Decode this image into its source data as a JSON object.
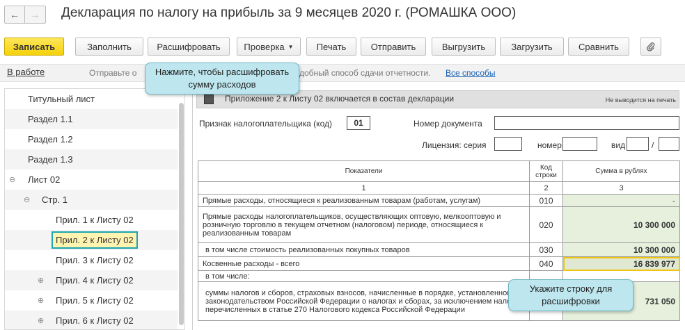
{
  "window": {
    "title": "Декларация по налогу на прибыль за 9 месяцев 2020 г. (РОМАШКА ООО)",
    "back_icon": "arrow-left",
    "forward_icon": "arrow-right"
  },
  "toolbar": {
    "save": "Записать",
    "fill": "Заполнить",
    "decode": "Расшифровать",
    "check": "Проверка",
    "print": "Печать",
    "send": "Отправить",
    "export": "Выгрузить",
    "import": "Загрузить",
    "compare": "Сравнить",
    "attach_icon": "paperclip",
    "accent_color": "#f5d20a"
  },
  "status": {
    "work_link": "В работе",
    "hint_start": "Отправьте о",
    "hint_end": "добный способ сдачи отчетности.",
    "all_ways_link": "Все способы"
  },
  "tooltips": {
    "decode_hint": "Нажмите, чтобы расшифровать сумму расходов",
    "row_hint": "Укажите строку для расшифровки"
  },
  "sidebar": {
    "items": [
      {
        "label": "Титульный лист"
      },
      {
        "label": "Раздел 1.1"
      },
      {
        "label": "Раздел 1.2"
      },
      {
        "label": "Раздел 1.3"
      },
      {
        "label": "Лист 02",
        "toggle": "⊖"
      },
      {
        "label": "Стр. 1",
        "toggle": "⊖"
      },
      {
        "label": "Прил. 1 к Листу 02"
      },
      {
        "label": "Прил. 2 к Листу 02"
      },
      {
        "label": "Прил. 3 к Листу 02"
      },
      {
        "label": "Прил. 4 к Листу 02",
        "toggle": "⊕"
      },
      {
        "label": "Прил. 5 к Листу 02",
        "toggle": "⊕"
      },
      {
        "label": "Прил. 6 к Листу 02",
        "toggle": "⊕"
      }
    ]
  },
  "form": {
    "appendix_label": "Приложение 2 к Листу 02 включается в состав декларации",
    "no_print": "Не выводится на печать",
    "taxpayer_sign_label": "Признак налогоплательщика (код)",
    "taxpayer_sign_value": "01",
    "doc_number_label": "Номер документа",
    "license_series_label": "Лицензия: серия",
    "number_label": "номер",
    "type_label": "вид",
    "slash": "/"
  },
  "table": {
    "headers": [
      "Показатели",
      "Код строки",
      "Сумма в рублях"
    ],
    "col_numbers": [
      "1",
      "2",
      "3"
    ],
    "rows": [
      {
        "label": "Прямые расходы, относящиеся к реализованным товарам (работам, услугам)",
        "code": "010",
        "sum": "-"
      },
      {
        "label": "Прямые расходы налогоплательщиков, осуществляющих оптовую, мелкооптовую и розничную торговлю в текущем отчетном (налоговом) периоде, относящиеся к реализованным товарам",
        "code": "020",
        "sum": "10 300 000"
      },
      {
        "label": "в том числе стоимость реализованных покупных товаров",
        "code": "030",
        "sum": "10 300 000"
      },
      {
        "label": "Косвенные расходы - всего",
        "code": "040",
        "sum": "16 839 977"
      },
      {
        "label": "в том числе:",
        "code": "",
        "sum": ""
      },
      {
        "label": "суммы налогов и сборов, страховых взносов, начисленные в порядке, установленном законодательством Российской Федерации о налогах и сборах, за исключением налогов, перечисленных в статье 270 Налогового кодекса Российской Федерации",
        "code": "",
        "sum": "731 050"
      }
    ]
  }
}
